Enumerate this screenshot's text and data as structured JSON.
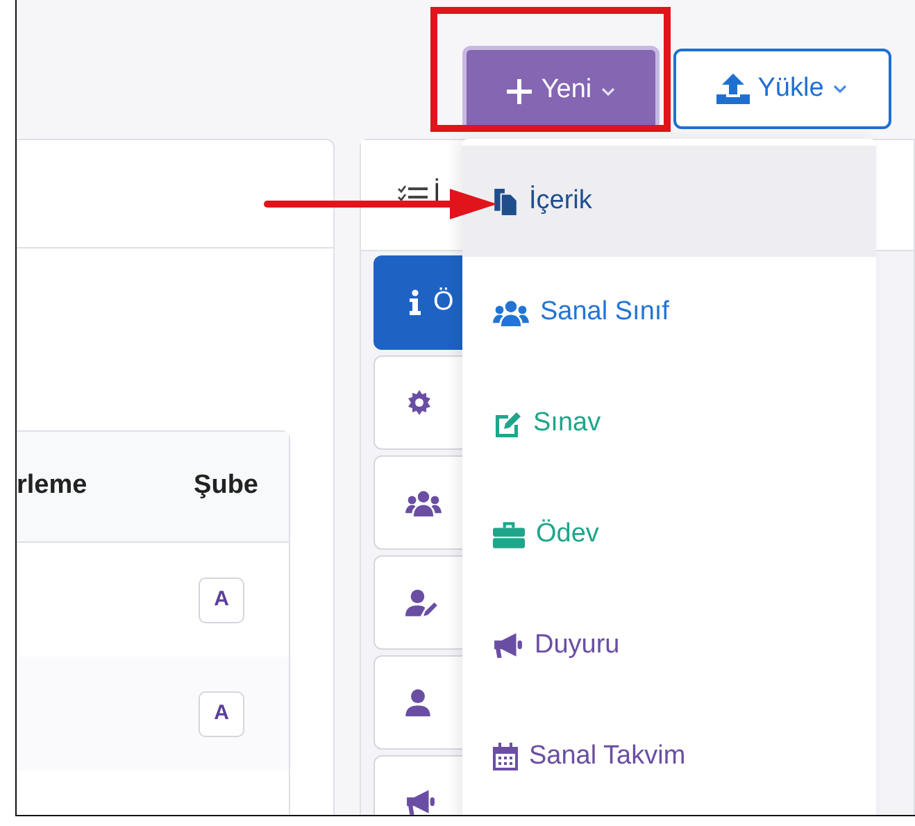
{
  "toolbar": {
    "new_button": {
      "label": "Yeni"
    },
    "upload_button": {
      "label": "Yükle"
    }
  },
  "left_panel": {
    "table": {
      "columns": [
        "rleme",
        "Şube"
      ],
      "rows": [
        {
          "column_2": "A"
        },
        {
          "column_2": "A"
        }
      ]
    }
  },
  "right_panel": {
    "header": "İ",
    "tabs": [
      {
        "kind": "info",
        "label": "Ö",
        "selected": true
      },
      {
        "kind": "gear",
        "selected": false
      },
      {
        "kind": "users",
        "selected": false
      },
      {
        "kind": "user-edit",
        "selected": false
      },
      {
        "kind": "user",
        "selected": false
      },
      {
        "kind": "megaphone",
        "selected": false
      }
    ]
  },
  "dropdown": {
    "items": [
      {
        "kind": "content",
        "label": "İçerik",
        "color": "#1f4e8c",
        "highlighted": true
      },
      {
        "kind": "class",
        "label": "Sanal Sınıf",
        "color": "#2275d4",
        "highlighted": false
      },
      {
        "kind": "exam",
        "label": "Sınav",
        "color": "#1fa58a",
        "highlighted": false
      },
      {
        "kind": "homework",
        "label": "Ödev",
        "color": "#1fa58a",
        "highlighted": false
      },
      {
        "kind": "announcement",
        "label": "Duyuru",
        "color": "#6a4ea3",
        "highlighted": false
      },
      {
        "kind": "calendar",
        "label": "Sanal Takvim",
        "color": "#6a4ea3",
        "highlighted": false
      }
    ]
  },
  "annotations": {
    "red_frame_on_new_button": true,
    "red_arrow_to_first_item": true
  }
}
